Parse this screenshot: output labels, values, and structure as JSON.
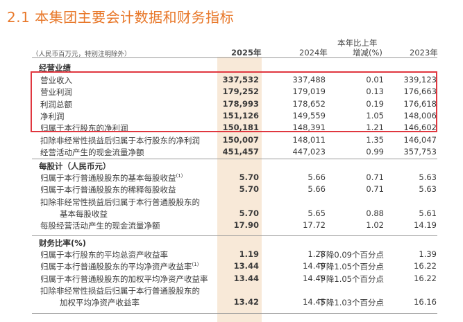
{
  "title": "2.1 本集团主要会计数据和财务指标",
  "header": {
    "unit_note": "（人民币百万元，特别注明除外）",
    "col_2025": "2025年",
    "col_2024": "2024年",
    "col_change_line1": "本年比上年",
    "col_change_line2": "增减(%)",
    "col_2023": "2023年"
  },
  "sections": [
    {
      "heading": "经营业绩",
      "rows": [
        {
          "label": "营业收入",
          "sup": "",
          "v2025": "337,532",
          "v2024": "337,488",
          "change": "0.01",
          "v2023": "339,123"
        },
        {
          "label": "营业利润",
          "sup": "",
          "v2025": "179,252",
          "v2024": "179,019",
          "change": "0.13",
          "v2023": "176,663"
        },
        {
          "label": "利润总额",
          "sup": "",
          "v2025": "178,993",
          "v2024": "178,652",
          "change": "0.19",
          "v2023": "176,618"
        },
        {
          "label": "净利润",
          "sup": "",
          "v2025": "151,126",
          "v2024": "149,559",
          "change": "1.05",
          "v2023": "148,006"
        },
        {
          "label": "归属于本行股东的净利润",
          "sup": "",
          "v2025": "150,181",
          "v2024": "148,391",
          "change": "1.21",
          "v2023": "146,602"
        },
        {
          "label": "扣除非经常性损益后归属于本行股东的净利润",
          "sup": "",
          "v2025": "150,007",
          "v2024": "148,011",
          "change": "1.35",
          "v2023": "146,047"
        },
        {
          "label": "经营活动产生的现金流量净额",
          "sup": "",
          "v2025": "451,457",
          "v2024": "447,023",
          "change": "0.99",
          "v2023": "357,753"
        }
      ]
    },
    {
      "heading": "每股计（人民币元）",
      "rows": [
        {
          "label": "归属于本行普通股股东的基本每股收益",
          "sup": "(1)",
          "v2025": "5.70",
          "v2024": "5.66",
          "change": "0.71",
          "v2023": "5.63"
        },
        {
          "label": "归属于本行普通股股东的稀释每股收益",
          "sup": "",
          "v2025": "5.70",
          "v2024": "5.66",
          "change": "0.71",
          "v2023": "5.63"
        },
        {
          "label": "扣除非经常性损益后归属于本行普通股股东的",
          "sup": "",
          "v2025": "",
          "v2024": "",
          "change": "",
          "v2023": ""
        },
        {
          "label": "基本每股收益",
          "sup": "",
          "indent": true,
          "v2025": "5.70",
          "v2024": "5.65",
          "change": "0.88",
          "v2023": "5.61"
        },
        {
          "label": "每股经营活动产生的现金流量净额",
          "sup": "",
          "v2025": "17.90",
          "v2024": "17.72",
          "change": "1.02",
          "v2023": "14.19"
        }
      ]
    },
    {
      "heading": "财务比率(%)",
      "rows": [
        {
          "label": "归属于本行股东的平均总资产收益率",
          "sup": "",
          "v2025": "1.19",
          "v2024": "1.28",
          "change": "下降0.09个百分点",
          "v2023": "1.39"
        },
        {
          "label": "归属于本行普通股股东的平均净资产收益率",
          "sup": "(1)",
          "v2025": "13.44",
          "v2024": "14.49",
          "change": "下降1.05个百分点",
          "v2023": "16.22"
        },
        {
          "label": "归属于本行普通股股东的加权平均净资产收益率",
          "sup": "",
          "v2025": "13.44",
          "v2024": "14.49",
          "change": "下降1.05个百分点",
          "v2023": "16.22"
        },
        {
          "label": "扣除非经常性损益后归属于本行普通股股东的",
          "sup": "",
          "v2025": "",
          "v2024": "",
          "change": "",
          "v2023": ""
        },
        {
          "label": "加权平均净资产收益率",
          "sup": "",
          "indent": true,
          "v2025": "13.42",
          "v2024": "14.45",
          "change": "下降1.03个百分点",
          "v2023": "16.16"
        }
      ]
    }
  ]
}
